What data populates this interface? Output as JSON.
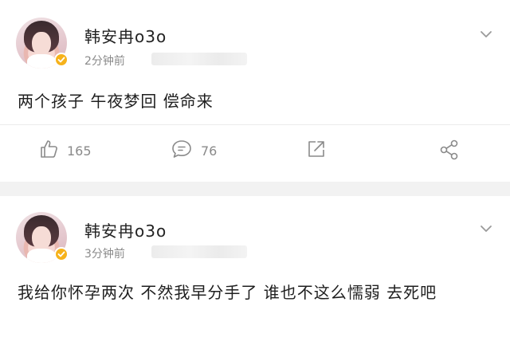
{
  "colors": {
    "background": "#f2f2f2",
    "card": "#ffffff",
    "text": "#1f1f1f",
    "muted": "#8a8a8a",
    "verify_badge": "#f6b21b"
  },
  "posts": [
    {
      "username": "韩安冉o3o",
      "timestamp": "2分钟前",
      "text": "两个孩子 午夜梦回 偿命来",
      "actions": {
        "like_icon": "thumbs-up-icon",
        "like_count": "165",
        "comment_icon": "comment-icon",
        "comment_count": "76",
        "repost_icon": "repost-icon",
        "share_icon": "share-icon"
      }
    },
    {
      "username": "韩安冉o3o",
      "timestamp": "3分钟前",
      "text": "我给你怀孕两次 不然我早分手了 谁也不这么懦弱 去死吧"
    }
  ]
}
